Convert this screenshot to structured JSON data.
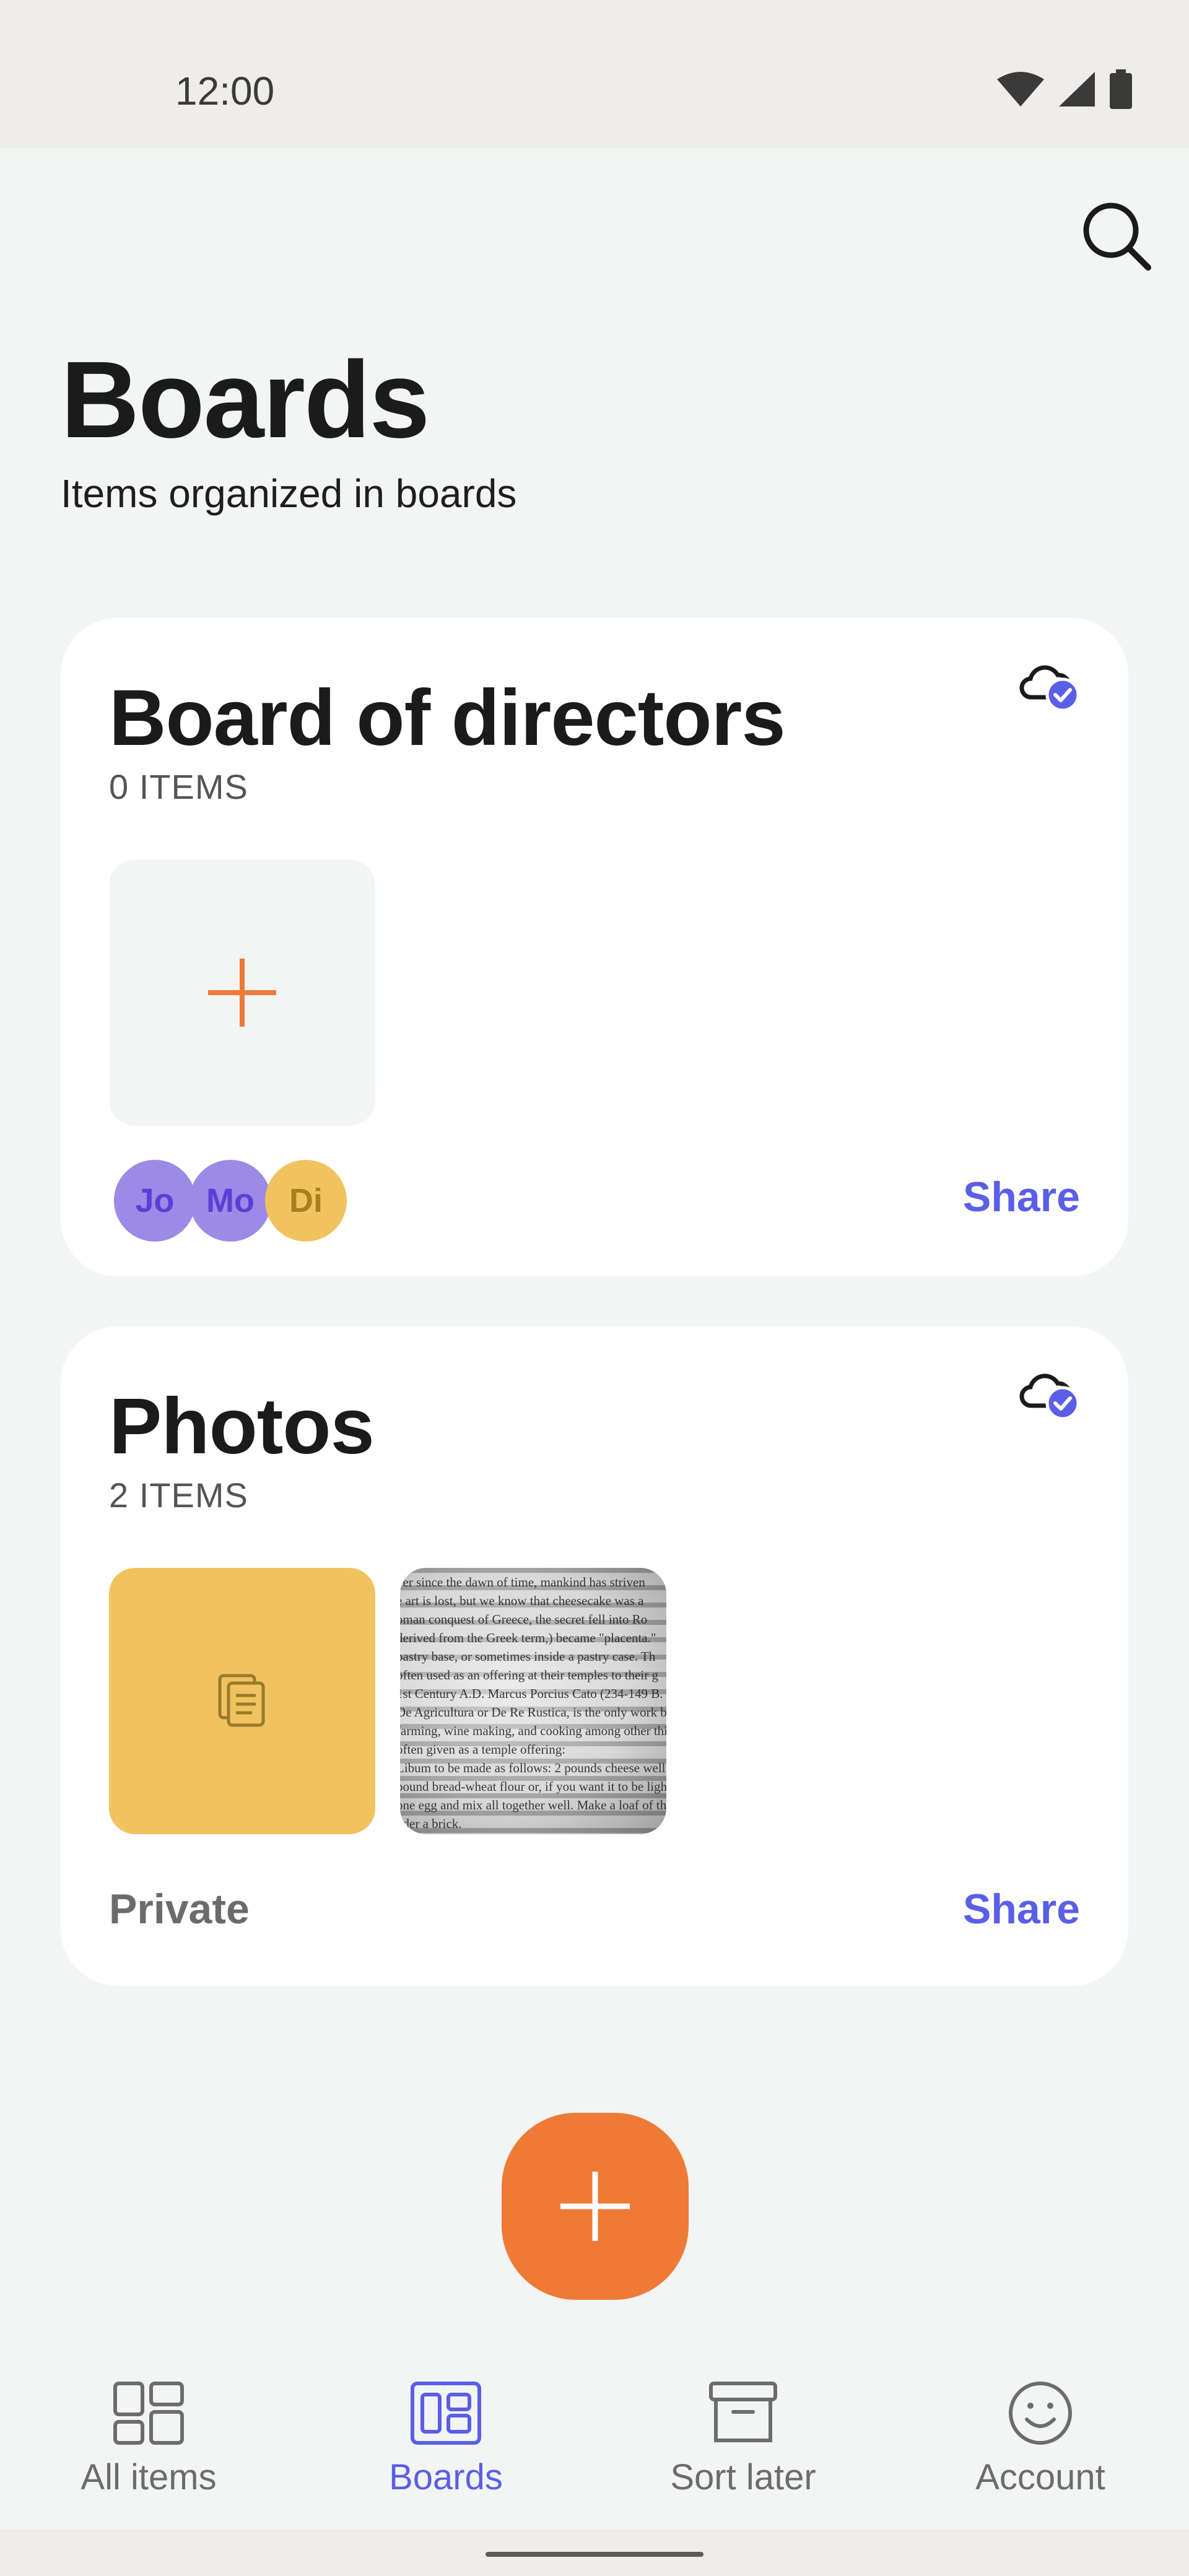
{
  "status_bar": {
    "time": "12:00",
    "icons": [
      "wifi-icon",
      "signal-icon",
      "battery-icon"
    ]
  },
  "header": {
    "title": "Boards",
    "subtitle": "Items organized in boards",
    "search_icon": "search-icon"
  },
  "boards": [
    {
      "title": "Board of directors",
      "count": "0 ITEMS",
      "sync_icon": "cloud-check-icon",
      "members": [
        "Jo",
        "Mo",
        "Di"
      ],
      "share_label": "Share"
    },
    {
      "title": "Photos",
      "count": "2 ITEMS",
      "sync_icon": "cloud-check-icon",
      "visibility": "Private",
      "share_label": "Share"
    }
  ],
  "photo_thumbnail_text": [
    "ver since the dawn of time, mankind has striven",
    "e art is lost, but we know that cheesecake was a",
    "oman conquest of Greece, the secret fell into Ro",
    "derived from the Greek term,) became \"placenta.\"",
    "pastry base, or sometimes inside a pastry case. Th",
    "often used as an offering at their temples to their g",
    "1st Century A.D. Marcus Porcius Cato (234-149 B.",
    "De Agricultura or De Re Rustica, is the only work b",
    "farming, wine making, and cooking among other thi",
    "often given as a temple offering:",
    "Libum to be made as follows: 2 pounds cheese well c",
    "pound bread-wheat flour or, if you want it to be light",
    "one egg and mix all together well. Make a loaf of thi",
    "nder a brick."
  ],
  "fab": {
    "icon": "plus-icon"
  },
  "bottom_nav": [
    {
      "label": "All items",
      "icon": "all-items-icon",
      "active": false
    },
    {
      "label": "Boards",
      "icon": "boards-icon",
      "active": true
    },
    {
      "label": "Sort later",
      "icon": "archive-icon",
      "active": false
    },
    {
      "label": "Account",
      "icon": "smiley-icon",
      "active": false
    }
  ],
  "colors": {
    "accent": "#5b5ee6",
    "fab": "#ee7a36",
    "note_tile": "#f0c35f",
    "avatar_purple": "#9b8ae6",
    "avatar_yellow": "#f0c35f"
  }
}
